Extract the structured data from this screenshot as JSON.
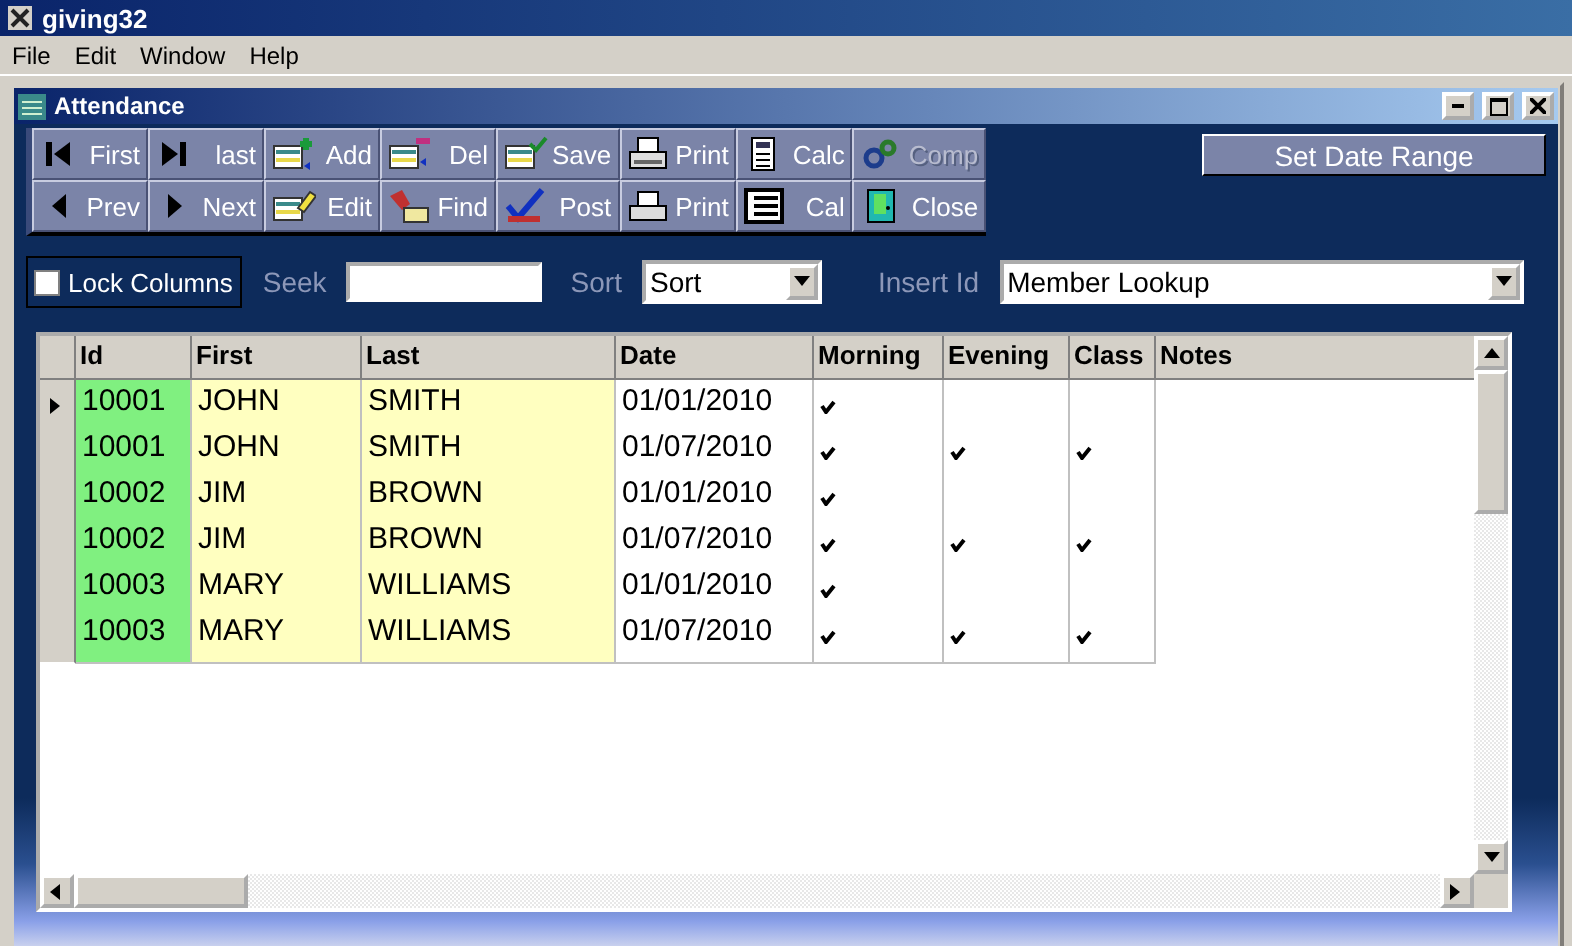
{
  "app_title": "giving32",
  "menu": [
    "File",
    "Edit",
    "Window",
    "Help"
  ],
  "window": {
    "title": "Attendance"
  },
  "toolbar": [
    [
      {
        "label": "First",
        "disabled": false
      },
      {
        "label": "last",
        "disabled": false
      },
      {
        "label": "Add",
        "disabled": false
      },
      {
        "label": "Del",
        "disabled": false
      },
      {
        "label": "Save",
        "disabled": false
      },
      {
        "label": "Print",
        "disabled": false
      },
      {
        "label": "Calc",
        "disabled": false
      },
      {
        "label": "Comp",
        "disabled": true
      }
    ],
    [
      {
        "label": "Prev",
        "disabled": false
      },
      {
        "label": "Next",
        "disabled": false
      },
      {
        "label": "Edit",
        "disabled": false
      },
      {
        "label": "Find",
        "disabled": false
      },
      {
        "label": "Post",
        "disabled": false
      },
      {
        "label": "Print",
        "disabled": false
      },
      {
        "label": "Cal",
        "disabled": false
      },
      {
        "label": "Close",
        "disabled": false
      }
    ]
  ],
  "date_range_button": "Set Date Range",
  "lock_columns": {
    "label": "Lock Columns",
    "checked": false
  },
  "seek": {
    "label": "Seek"
  },
  "sort": {
    "label": "Sort",
    "value": "Sort"
  },
  "insert_id": {
    "label": "Insert Id",
    "value": "Member Lookup"
  },
  "table": {
    "columns": [
      "Id",
      "First",
      "Last",
      "Date",
      "Morning",
      "Evening",
      "Class",
      "Notes"
    ],
    "rows": [
      {
        "selected": true,
        "id": "10001",
        "first": "JOHN",
        "last": "SMITH",
        "date": "01/01/2010",
        "morning": true,
        "evening": false,
        "class": false
      },
      {
        "selected": false,
        "id": "10001",
        "first": "JOHN",
        "last": "SMITH",
        "date": "01/07/2010",
        "morning": true,
        "evening": true,
        "class": true
      },
      {
        "selected": false,
        "id": "10002",
        "first": "JIM",
        "last": "BROWN",
        "date": "01/01/2010",
        "morning": true,
        "evening": false,
        "class": false
      },
      {
        "selected": false,
        "id": "10002",
        "first": "JIM",
        "last": "BROWN",
        "date": "01/07/2010",
        "morning": true,
        "evening": true,
        "class": true
      },
      {
        "selected": false,
        "id": "10003",
        "first": "MARY",
        "last": "WILLIAMS",
        "date": "01/01/2010",
        "morning": true,
        "evening": false,
        "class": false
      },
      {
        "selected": false,
        "id": "10003",
        "first": "MARY",
        "last": "WILLIAMS",
        "date": "01/07/2010",
        "morning": true,
        "evening": true,
        "class": true
      }
    ]
  }
}
